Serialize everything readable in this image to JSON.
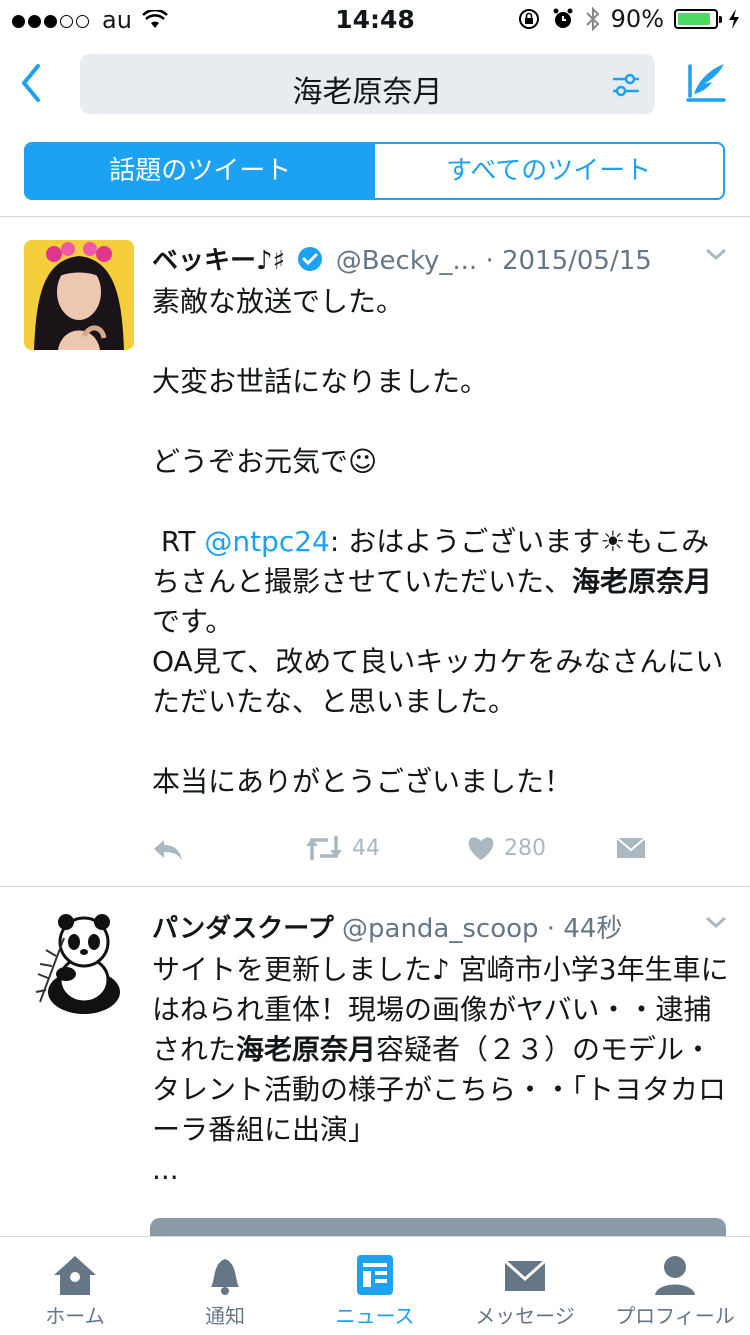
{
  "status_bar": {
    "carrier": "au",
    "time": "14:48",
    "battery": "90%",
    "battery_level": 0.9
  },
  "nav": {
    "search_query": "海老原奈月"
  },
  "tabs": [
    {
      "label": "話題のツイート",
      "active": true
    },
    {
      "label": "すべてのツイート",
      "active": false
    }
  ],
  "tweets": [
    {
      "name": "ベッキー♪♯",
      "handle": "@Becky_...",
      "date": "· 2015/05/15",
      "body_a": "素敵な放送でした。\n\n大変お世話になりました。\n\nどうぞお元気で☺\n\n RT ",
      "mention": "@ntpc24",
      "body_b": ": おはようございます☀もこみちさんと撮影させていただいた、",
      "bold": "海老原奈月",
      "body_c": "です。\nOA見て、改めて良いキッカケをみなさんにいただいたな、と思いました。\n\n本当にありがとうございました！",
      "retweets": "44",
      "likes": "280"
    },
    {
      "name": "パンダスクープ",
      "handle": "@panda_scoop",
      "date": "· 44秒",
      "body_a": "サイトを更新しました♪ 宮崎市小学3年生車にはねられ重体！現場の画像がヤバい・・逮捕された",
      "bold": "海老原奈月",
      "body_b": "容疑者（２３）のモデル・タレント活動の様子がこちら・・「トヨタカローラ番組に出演」\n..."
    }
  ],
  "tab_bar": [
    {
      "label": "ホーム",
      "icon": "home-icon"
    },
    {
      "label": "通知",
      "icon": "bell-icon"
    },
    {
      "label": "ニュース",
      "icon": "news-icon",
      "active": true
    },
    {
      "label": "メッセージ",
      "icon": "envelope-icon"
    },
    {
      "label": "プロフィール",
      "icon": "person-icon"
    }
  ],
  "colors": {
    "accent": "#1da1f2",
    "battery": "#4cd964",
    "muted": "#657786",
    "icon_gray": "#aab8c2"
  }
}
